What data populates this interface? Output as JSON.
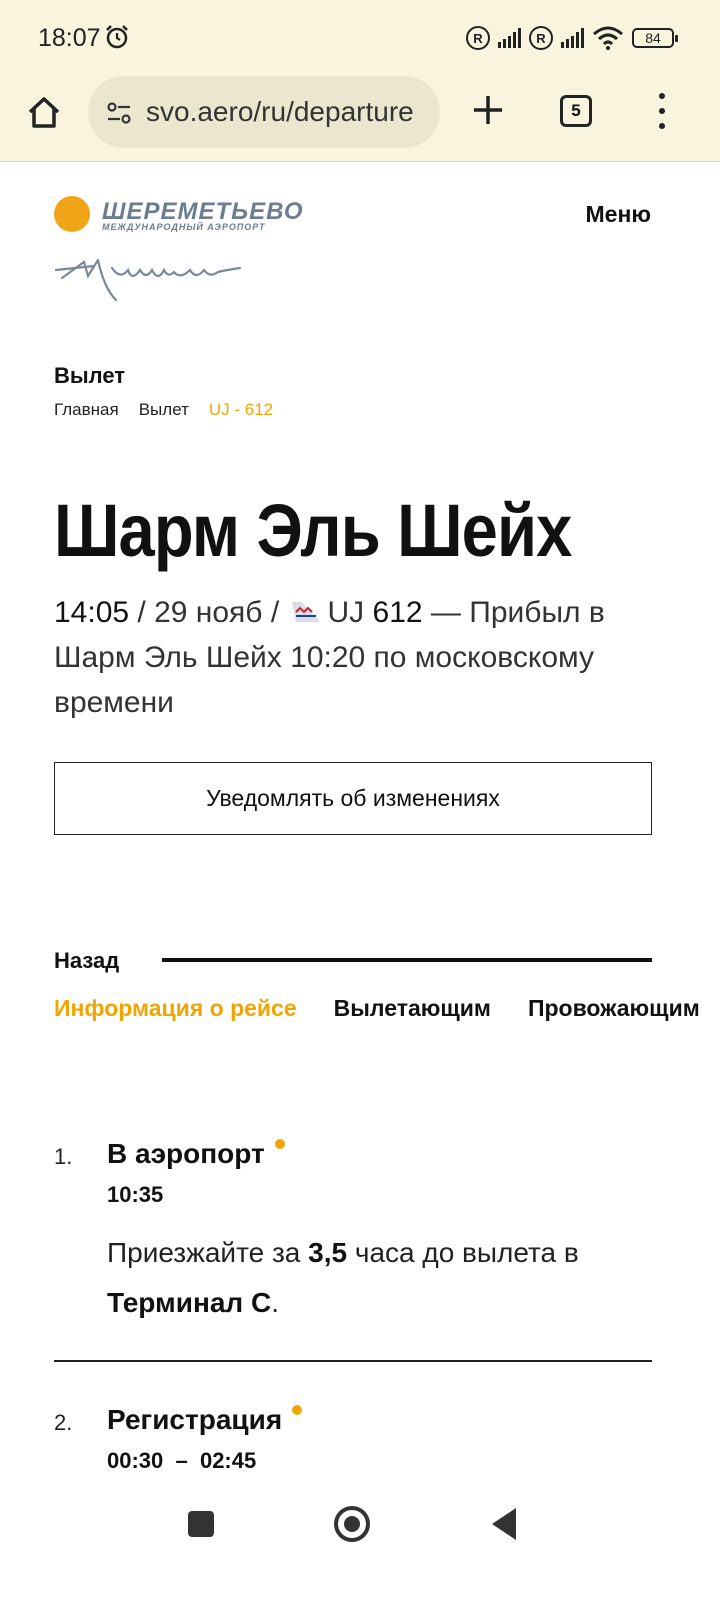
{
  "status_bar": {
    "time": "18:07",
    "battery": "84",
    "registered_mark": "R"
  },
  "browser": {
    "url": "svo.aero/ru/departure",
    "tab_count": "5"
  },
  "header": {
    "logo_line1": "ШЕРЕМЕТЬЕВО",
    "logo_line2": "МЕЖДУНАРОДНЫЙ АЭРОПОРТ",
    "menu_label": "Меню"
  },
  "section_title": "Вылет",
  "breadcrumb": {
    "home": "Главная",
    "departure": "Вылет",
    "current": "UJ - 612"
  },
  "flight": {
    "destination": "Шарм Эль Шейх",
    "time": "14:05",
    "date": "29 нояб",
    "airline_code": "UJ",
    "flight_number": "612",
    "status_text": "— Прибыл в Шарм Эль Шейх 10:20 по московскому времени"
  },
  "notify_button": "Уведомлять об изменениях",
  "back_label": "Назад",
  "tabs": [
    {
      "label": "Информация о рейсе",
      "active": true
    },
    {
      "label": "Вылетающим",
      "active": false
    },
    {
      "label": "Провожающим",
      "active": false
    }
  ],
  "steps": [
    {
      "number": "1.",
      "title": "В аэропорт",
      "time": "10:35",
      "text_1": "Приезжайте за ",
      "text_2": "3,5",
      "text_3": " часа до вылета в ",
      "text_4": "Терминал С",
      "text_5": "."
    },
    {
      "number": "2.",
      "title": "Регистрация",
      "time": "00:30  –  02:45"
    }
  ],
  "colors": {
    "accent": "#f0a500",
    "browser_bg": "#f8f4dd",
    "logo_blue_gray": "#6b7d92"
  },
  "icons": {
    "alarm": "alarm-clock-icon",
    "home": "home-icon",
    "site_info": "site-settings-icon",
    "new_tab": "plus-icon",
    "overflow": "more-vert-icon",
    "airline": "airline-tail-icon"
  }
}
